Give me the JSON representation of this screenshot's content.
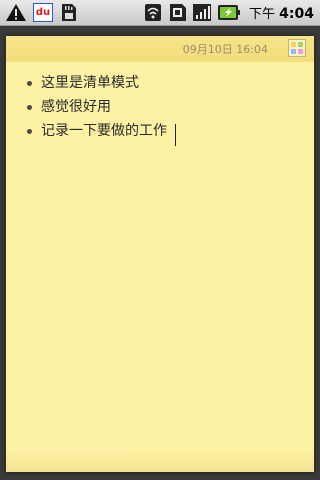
{
  "status_bar": {
    "icons": [
      "warning-icon",
      "baidu-du-icon",
      "sd-card-icon",
      "wifi-icon",
      "sim-icon",
      "signal-icon",
      "battery-charging-icon"
    ],
    "baidu_label": "du",
    "time_prefix": "下午",
    "time": "4:04"
  },
  "note": {
    "timestamp": "09月10日 16:04",
    "background_color": "#fdf1a3",
    "header_color": "#f3de7c",
    "items": [
      {
        "text": "这里是清单模式"
      },
      {
        "text": "感觉很好用"
      },
      {
        "text": "记录一下要做的工作"
      }
    ]
  }
}
